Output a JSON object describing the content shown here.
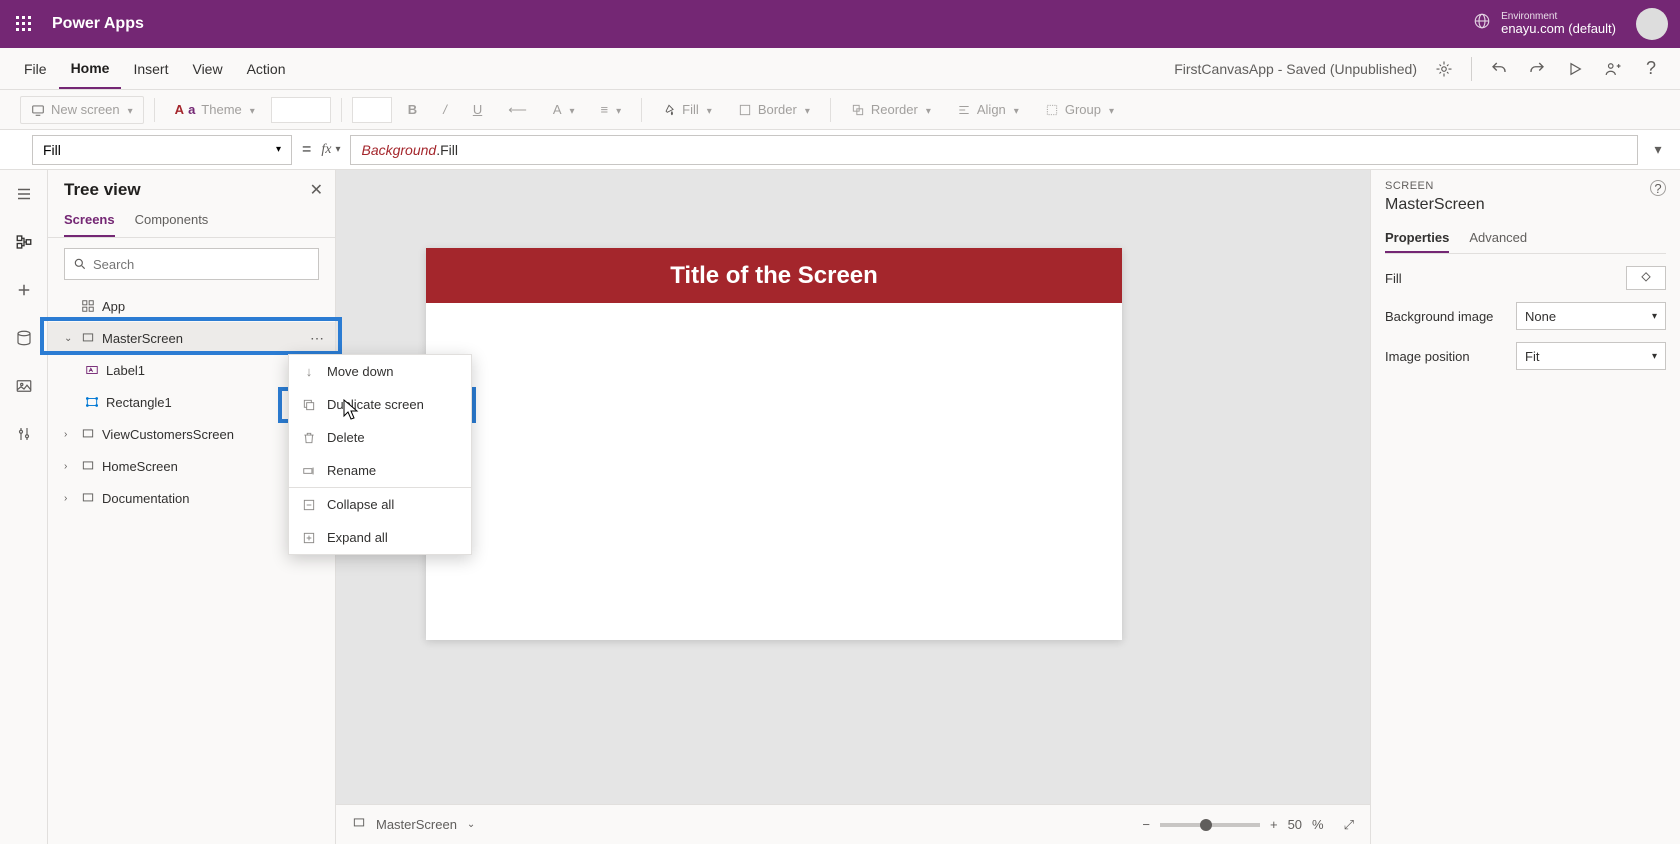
{
  "header": {
    "brand": "Power Apps",
    "env_label": "Environment",
    "env_name": "enayu.com (default)"
  },
  "menu": {
    "items": [
      "File",
      "Home",
      "Insert",
      "View",
      "Action"
    ],
    "active": "Home",
    "app_status": "FirstCanvasApp - Saved (Unpublished)"
  },
  "toolbar": {
    "new_screen": "New screen",
    "theme": "Theme",
    "fill": "Fill",
    "border": "Border",
    "reorder": "Reorder",
    "align": "Align",
    "group": "Group"
  },
  "formula": {
    "property": "Fill",
    "expr_ident": "Background",
    "expr_member": ".Fill"
  },
  "tree": {
    "title": "Tree view",
    "tabs": [
      "Screens",
      "Components"
    ],
    "active_tab": "Screens",
    "search_placeholder": "Search",
    "items": {
      "app": "App",
      "master": "MasterScreen",
      "label1": "Label1",
      "rect1": "Rectangle1",
      "viewcust": "ViewCustomersScreen",
      "home": "HomeScreen",
      "doc": "Documentation"
    }
  },
  "context_menu": {
    "move_down": "Move down",
    "duplicate": "Duplicate screen",
    "delete": "Delete",
    "rename": "Rename",
    "collapse": "Collapse all",
    "expand": "Expand all"
  },
  "canvas": {
    "screen_title": "Title of the Screen",
    "footer_screen": "MasterScreen",
    "zoom_value": "50",
    "zoom_suffix": "%"
  },
  "props": {
    "section": "SCREEN",
    "screen_name": "MasterScreen",
    "tabs": [
      "Properties",
      "Advanced"
    ],
    "fill_label": "Fill",
    "bg_image_label": "Background image",
    "bg_image_value": "None",
    "img_pos_label": "Image position",
    "img_pos_value": "Fit"
  }
}
